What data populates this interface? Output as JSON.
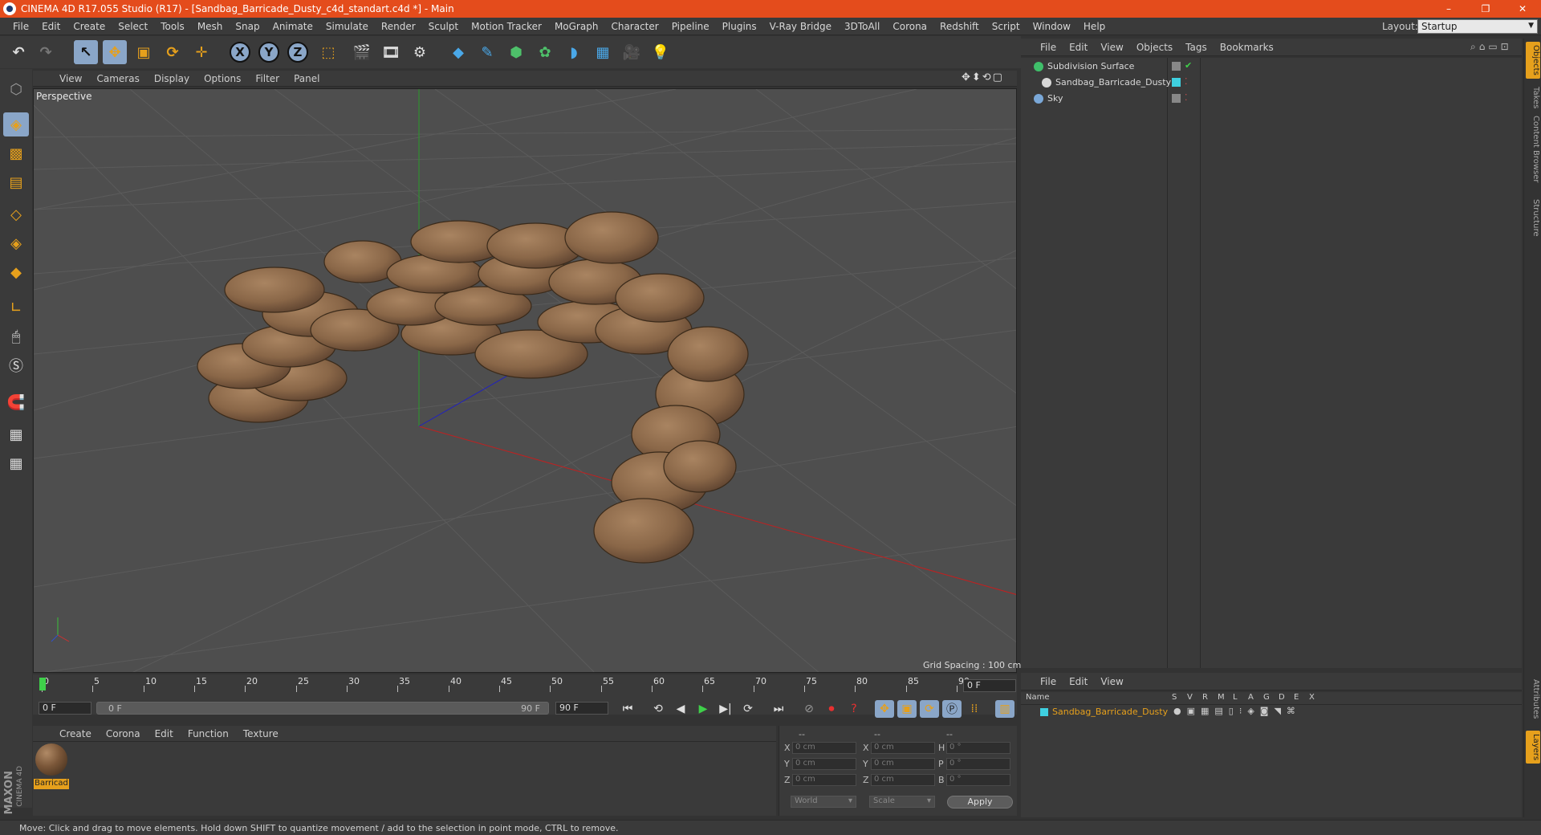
{
  "window": {
    "title": "CINEMA 4D R17.055 Studio (R17) - [Sandbag_Barricade_Dusty_c4d_standart.c4d *] - Main",
    "controls": [
      "–",
      "❐",
      "✕"
    ]
  },
  "menubar": {
    "items": [
      "File",
      "Edit",
      "Create",
      "Select",
      "Tools",
      "Mesh",
      "Snap",
      "Animate",
      "Simulate",
      "Render",
      "Sculpt",
      "Motion Tracker",
      "MoGraph",
      "Character",
      "Pipeline",
      "Plugins",
      "V-Ray Bridge",
      "3DToAll",
      "Corona",
      "Redshift",
      "Script",
      "Window",
      "Help"
    ],
    "layout_label": "Layout:",
    "layout_value": "Startup"
  },
  "toolbar": {
    "axis_x": "X",
    "axis_y": "Y",
    "axis_z": "Z"
  },
  "viewport": {
    "menu": [
      "View",
      "Cameras",
      "Display",
      "Options",
      "Filter",
      "Panel"
    ],
    "label": "Perspective",
    "grid_spacing": "Grid Spacing : 100 cm",
    "nav_icons": "✥⬍⟲▢"
  },
  "timeline": {
    "ticks": [
      "0",
      "5",
      "10",
      "15",
      "20",
      "25",
      "30",
      "35",
      "40",
      "45",
      "50",
      "55",
      "60",
      "65",
      "70",
      "75",
      "80",
      "85",
      "90"
    ],
    "current_frame": "0 F",
    "range_start": "0 F",
    "range_inner_start": "0 F",
    "range_inner_end": "90 F",
    "range_end": "90 F"
  },
  "material_manager": {
    "menu": [
      "Create",
      "Corona",
      "Edit",
      "Function",
      "Texture"
    ],
    "materials": [
      {
        "name": "Barricad"
      }
    ],
    "brand_top": "MAXON",
    "brand_bottom": "CINEMA 4D"
  },
  "coordinates": {
    "header": [
      "--",
      "--",
      "--"
    ],
    "rows": [
      {
        "a": "X",
        "av": "0 cm",
        "b": "X",
        "bv": "0 cm",
        "c": "H",
        "cv": "0 °"
      },
      {
        "a": "Y",
        "av": "0 cm",
        "b": "Y",
        "bv": "0 cm",
        "c": "P",
        "cv": "0 °"
      },
      {
        "a": "Z",
        "av": "0 cm",
        "b": "Z",
        "bv": "0 cm",
        "c": "B",
        "cv": "0 °"
      }
    ],
    "mode_world": "World",
    "mode_scale": "Scale",
    "apply": "Apply"
  },
  "object_manager": {
    "menu": [
      "File",
      "Edit",
      "View",
      "Objects",
      "Tags",
      "Bookmarks"
    ],
    "objects": [
      {
        "name": "Subdivision Surface",
        "icon_color": "#3fbf6a"
      },
      {
        "name": "Sandbag_Barricade_Dusty",
        "icon_color": "#d8d8d8"
      },
      {
        "name": "Sky",
        "icon_color": "#7aa8d8"
      }
    ]
  },
  "right_tabs": [
    "Objects",
    "Takes",
    "Content Browser",
    "Structure",
    "Attributes",
    "Layers"
  ],
  "layer_manager": {
    "menu": [
      "File",
      "Edit",
      "View"
    ],
    "columns": [
      "Name",
      "S",
      "V",
      "R",
      "M",
      "L",
      "A",
      "G",
      "D",
      "E",
      "X"
    ],
    "layers": [
      {
        "name": "Sandbag_Barricade_Dusty",
        "color": "#3fd0e0"
      }
    ]
  },
  "statusbar": {
    "text": "Move: Click and drag to move elements. Hold down SHIFT to quantize movement / add to the selection in point mode, CTRL to remove."
  },
  "colors": {
    "titlebar": "#e44c1c",
    "accent_orange": "#e6a01c",
    "active_blue": "#8aa6c8",
    "viewport_bg": "#4e4e4e"
  }
}
